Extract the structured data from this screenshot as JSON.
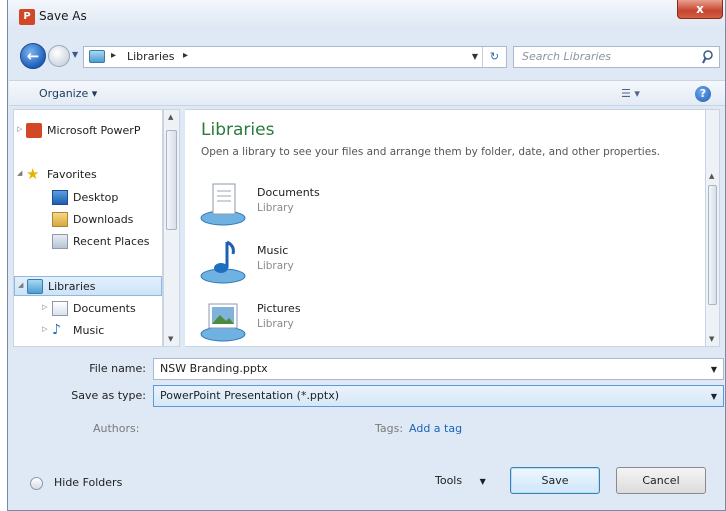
{
  "window": {
    "title": "Save As",
    "close_label": "x"
  },
  "address": {
    "path_segment": "Libraries",
    "search_placeholder": "Search Libraries"
  },
  "toolbar": {
    "organize_label": "Organize ▾"
  },
  "sidebar": {
    "items": [
      {
        "label": "Microsoft PowerP"
      },
      {
        "label": "Favorites"
      },
      {
        "label": "Desktop"
      },
      {
        "label": "Downloads"
      },
      {
        "label": "Recent Places"
      },
      {
        "label": "Libraries"
      },
      {
        "label": "Documents"
      },
      {
        "label": "Music"
      }
    ]
  },
  "main": {
    "title": "Libraries",
    "description": "Open a library to see your files and arrange them by folder, date, and other properties.",
    "libraries": [
      {
        "name": "Documents",
        "type": "Library"
      },
      {
        "name": "Music",
        "type": "Library"
      },
      {
        "name": "Pictures",
        "type": "Library"
      }
    ]
  },
  "form": {
    "file_name_label": "File name:",
    "file_name_value": "NSW Branding.pptx",
    "save_type_label": "Save as type:",
    "save_type_value": "PowerPoint Presentation (*.pptx)",
    "authors_label": "Authors:",
    "tags_label": "Tags:",
    "tags_link": "Add a tag"
  },
  "footer": {
    "hide_folders_label": "Hide Folders",
    "tools_label": "Tools",
    "save_label": "Save",
    "cancel_label": "Cancel"
  },
  "colors": {
    "accent": "#2a7a3a",
    "link": "#1c63b8",
    "close": "#c6452f"
  }
}
